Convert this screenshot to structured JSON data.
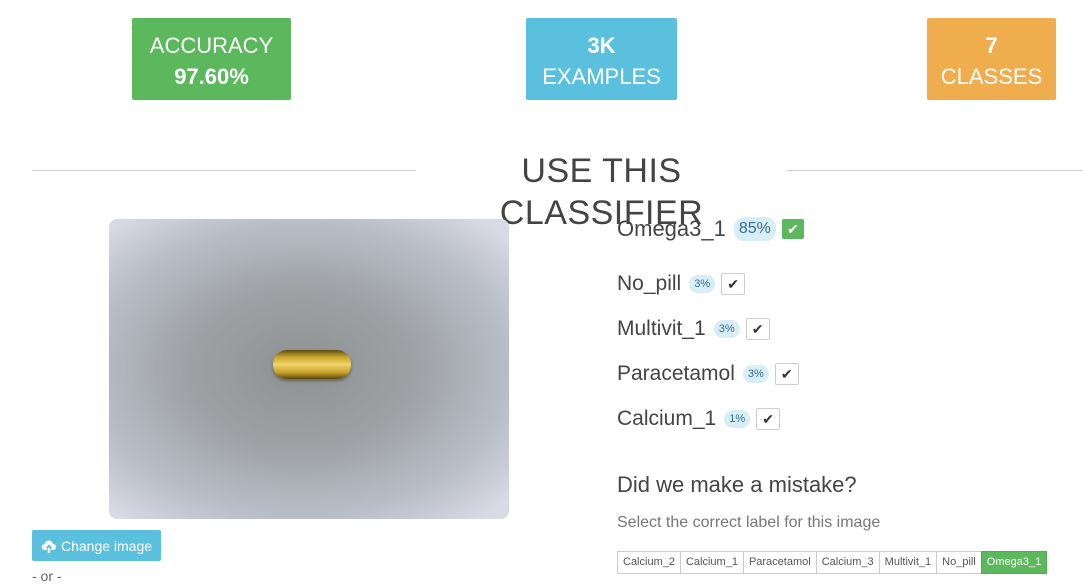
{
  "stats": {
    "accuracy": {
      "label": "ACCURACY",
      "value": "97.60%",
      "color": "#5cb85c"
    },
    "examples": {
      "value": "3K",
      "label": "EXAMPLES",
      "color": "#5bc0de"
    },
    "classes": {
      "value": "7",
      "label": "CLASSES",
      "color": "#f0ad4e"
    }
  },
  "section_title": "USE THIS CLASSIFIER",
  "change_image": {
    "icon": "cloud-upload-icon",
    "label": "Change image"
  },
  "or_text": "- or -",
  "predictions": [
    {
      "name": "Omega3_1",
      "pct": "85%",
      "icon": "check-icon"
    },
    {
      "name": "No_pill",
      "pct": "3%",
      "icon": "check-icon"
    },
    {
      "name": "Multivit_1",
      "pct": "3%",
      "icon": "check-icon"
    },
    {
      "name": "Paracetamol",
      "pct": "3%",
      "icon": "check-icon"
    },
    {
      "name": "Calcium_1",
      "pct": "1%",
      "icon": "check-icon"
    }
  ],
  "mistake": {
    "title": "Did we make a mistake?",
    "subtitle": "Select the correct label for this image"
  },
  "labels": [
    "Calcium_2",
    "Calcium_1",
    "Paracetamol",
    "Calcium_3",
    "Multivit_1",
    "No_pill",
    "Omega3_1"
  ],
  "selected_label": "Omega3_1"
}
